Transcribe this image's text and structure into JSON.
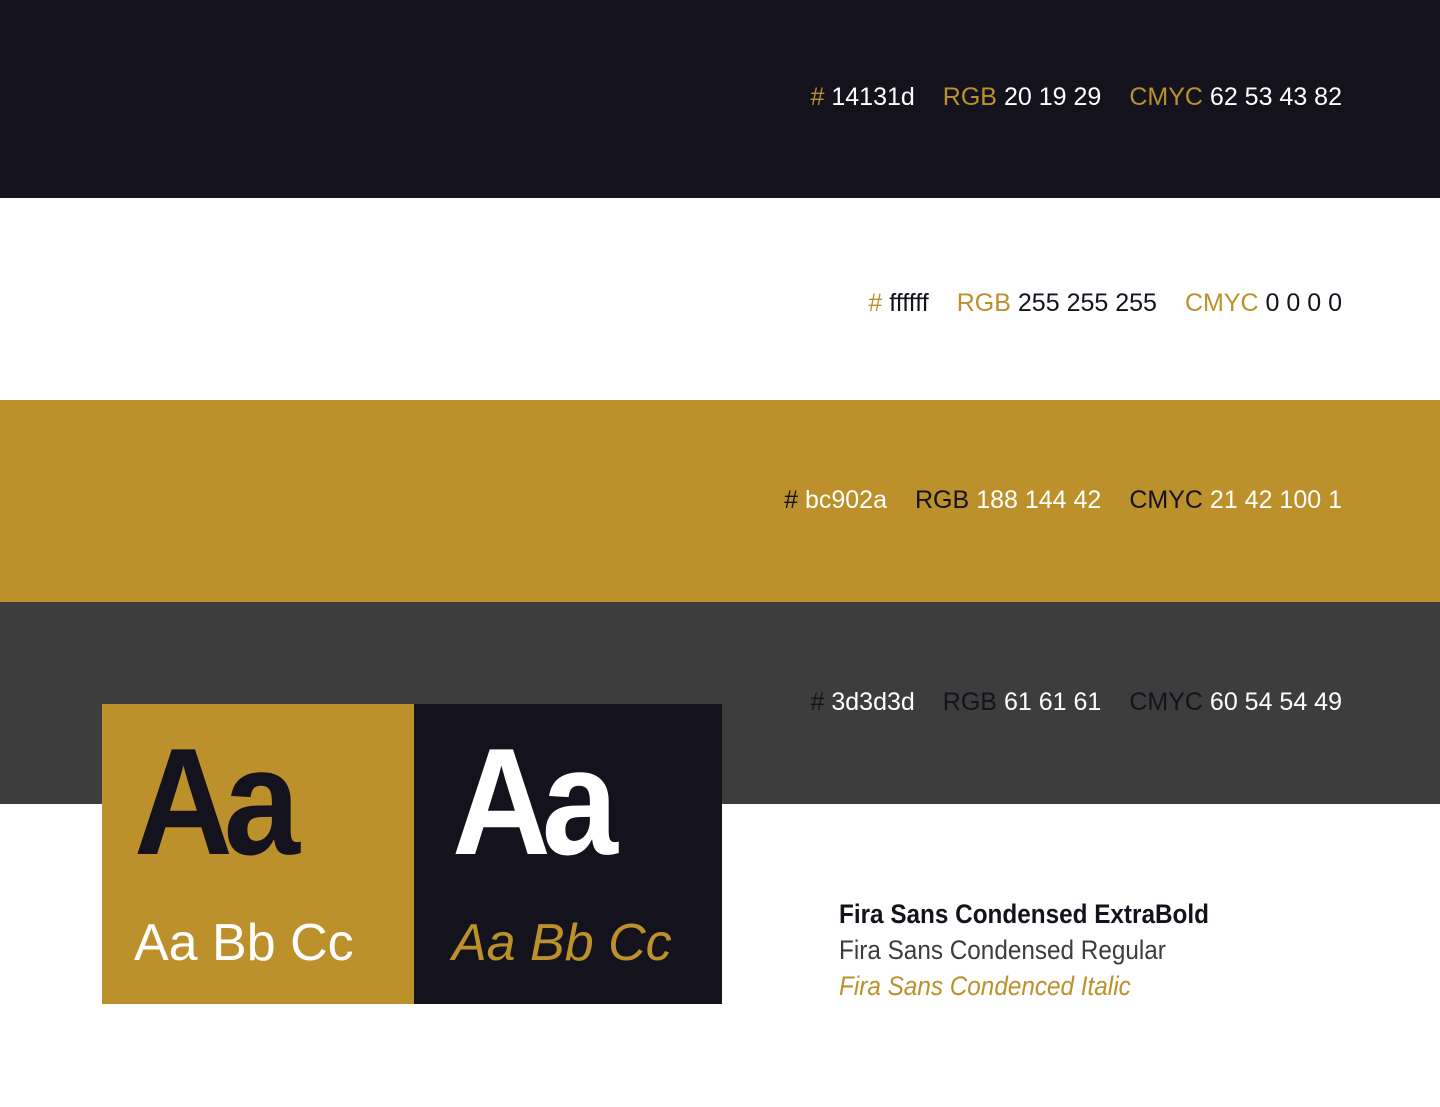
{
  "colors": {
    "dark": "#14131d",
    "white": "#ffffff",
    "gold": "#bc902a",
    "gray": "#3d3d3d"
  },
  "swatches": [
    {
      "hash_label": "#",
      "hex": "14131d",
      "rgb_label": "RGB",
      "rgb": "20 19 29",
      "cmyk_label": "CMYC",
      "cmyk": "62 53 43 82"
    },
    {
      "hash_label": "#",
      "hex": "ffffff",
      "rgb_label": "RGB",
      "rgb": "255 255 255",
      "cmyk_label": "CMYC",
      "cmyk": "0 0 0 0"
    },
    {
      "hash_label": "#",
      "hex": "bc902a",
      "rgb_label": "RGB",
      "rgb": "188 144 42",
      "cmyk_label": "CMYC",
      "cmyk": "21 42 100 1"
    },
    {
      "hash_label": "#",
      "hex": "3d3d3d",
      "rgb_label": "RGB",
      "rgb": "61 61 61",
      "cmyk_label": "CMYC",
      "cmyk": "60 54 54 49"
    }
  ],
  "type_cards": [
    {
      "big": "Aa",
      "sample": "Aa Bb Cc"
    },
    {
      "big": "Aa",
      "sample": "Aa Bb Cc"
    }
  ],
  "fonts": {
    "bold": "Fira Sans Condensed ExtraBold",
    "regular": "Fira Sans Condensed Regular",
    "italic": "Fira Sans Condenced Italic"
  }
}
